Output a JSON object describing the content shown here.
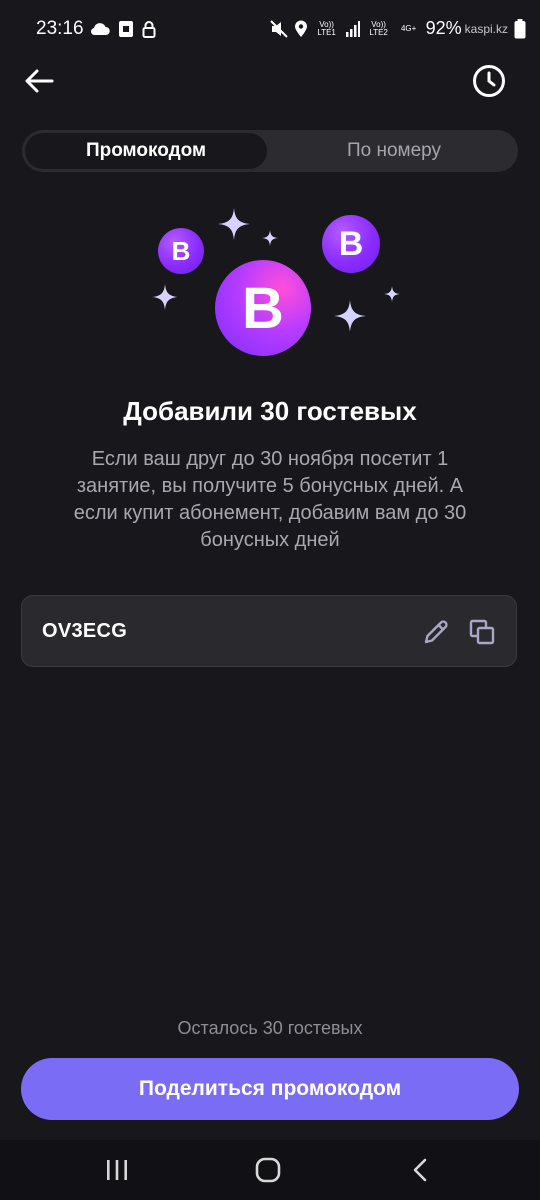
{
  "status_bar": {
    "time": "23:16",
    "network1": "Vo)) LTE1",
    "network2": "Vo)) LTE2",
    "network2_type": "4G+",
    "battery": "92%",
    "watermark": "kaspi.kz"
  },
  "header": {
    "back_icon": "arrow-left-icon",
    "history_icon": "clock-icon"
  },
  "tabs": [
    {
      "label": "Промокодом",
      "active": true
    },
    {
      "label": "По номеру",
      "active": false
    }
  ],
  "illustration": {
    "bubble_letter": "B",
    "colors": {
      "purple": "#8b2cff",
      "pink": "#ff4fd8",
      "sparkle": "#d7d3ff"
    }
  },
  "main": {
    "title": "Добавили 30 гостевых",
    "description": "Если ваш друг до 30 ноября посетит 1 занятие, вы получите 5 бонусных дней. А если купит абонемент, добавим вам до 30 бонусных дней"
  },
  "promo": {
    "code": "OV3ECG",
    "edit_icon": "pencil-icon",
    "copy_icon": "copy-icon"
  },
  "footer": {
    "remaining": "Осталось 30 гостевых",
    "share_label": "Поделиться промокодом",
    "accent_color": "#7b6cf6"
  },
  "nav": {
    "recent_icon": "recent-apps-icon",
    "home_icon": "home-icon",
    "back_icon": "back-icon"
  }
}
